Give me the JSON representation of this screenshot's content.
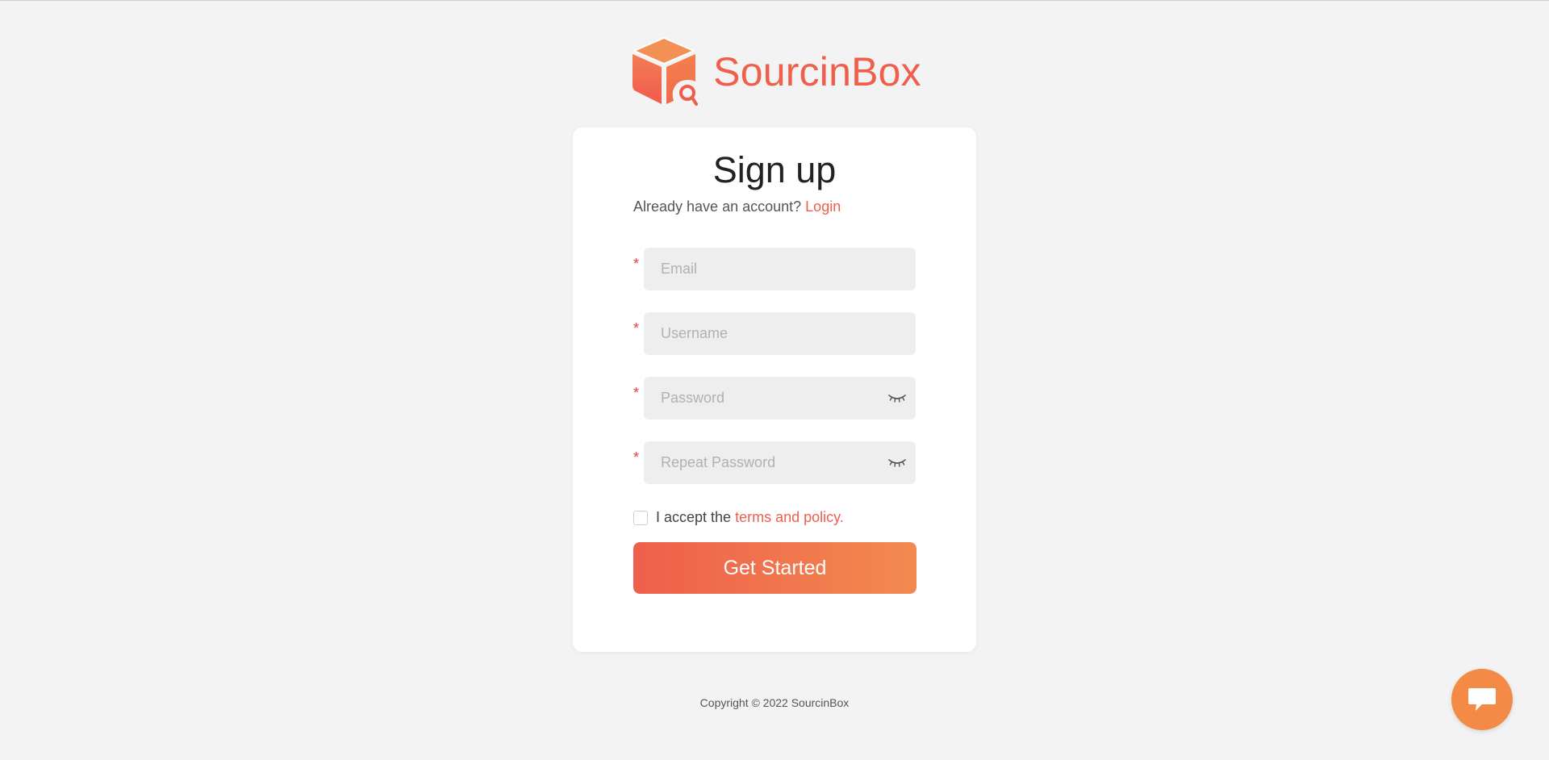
{
  "logo": {
    "text": "SourcinBox",
    "mark_icon": "cube-search-icon",
    "colors": {
      "top": "#f38f55",
      "gradient_start": "#f37d56",
      "gradient_end": "#f05b4c"
    }
  },
  "card": {
    "title": "Sign up",
    "login_prompt": "Already have an account?",
    "login_link": "Login"
  },
  "form": {
    "fields": [
      {
        "placeholder": "Email",
        "value": "",
        "required_mark": "*"
      },
      {
        "placeholder": "Username",
        "value": "",
        "required_mark": "*"
      },
      {
        "placeholder": "Password",
        "value": "",
        "required_mark": "*",
        "icon": "eye-closed-icon"
      },
      {
        "placeholder": "Repeat Password",
        "value": "",
        "required_mark": "*",
        "icon": "eye-closed-icon"
      }
    ],
    "terms_prefix": "I accept the",
    "terms_link": "terms and policy.",
    "terms_checked": false,
    "submit_label": "Get Started"
  },
  "footer": {
    "copyright": "Copyright © 2022 SourcinBox"
  },
  "chat": {
    "icon": "chat-bubble-icon",
    "color": "#f38a46"
  },
  "colors": {
    "accent": "#ef5f4c",
    "background": "#f3f3f3",
    "card": "#ffffff",
    "field": "#eeeeee",
    "required": "#f23c3c"
  }
}
